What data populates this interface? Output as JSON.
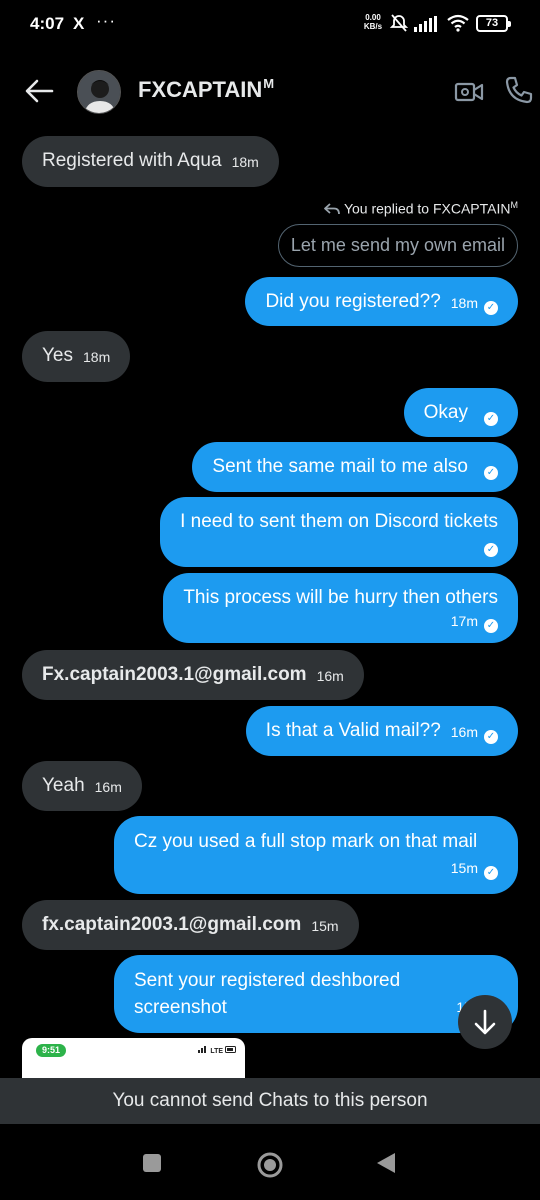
{
  "status_bar": {
    "time": "4:07",
    "x_icon": "X",
    "more": "···",
    "net_speed_value": "0.00",
    "net_speed_unit": "KB/s",
    "battery": "73"
  },
  "header": {
    "contact_name": "FXCAPTAIN",
    "contact_badge": "M"
  },
  "messages": [
    {
      "side": "in",
      "text": "Registered with Aqua",
      "time": "18m"
    },
    {
      "side": "out",
      "text": "Did you registered??",
      "time": "18m"
    },
    {
      "side": "in",
      "text": "Yes",
      "time": "18m"
    },
    {
      "side": "out",
      "text": "Okay",
      "time": ""
    },
    {
      "side": "out",
      "text": "Sent the same mail to me also",
      "time": ""
    },
    {
      "side": "out",
      "text": "I need to sent them on Discord tickets",
      "time": ""
    },
    {
      "side": "out",
      "text": "This process will be hurry then others",
      "time": "17m"
    },
    {
      "side": "in",
      "text": "Fx.captain2003.1@gmail.com",
      "time": "16m"
    },
    {
      "side": "out",
      "text": "Is that a Valid mail??",
      "time": "16m"
    },
    {
      "side": "in",
      "text": "Yeah",
      "time": "16m"
    },
    {
      "side": "out",
      "text": "Cz you used a full stop mark on that mail",
      "time": "15m"
    },
    {
      "side": "in",
      "text": "fx.captain2003.1@gmail.com",
      "time": "15m"
    },
    {
      "side": "out",
      "text": "Sent your registered deshbored screenshot",
      "time": "15"
    }
  ],
  "reply": {
    "note": "You replied to FXCAPTAIN",
    "note_badge": "M",
    "quoted_text": "Let me send my own email"
  },
  "thumbnail": {
    "time": "9:51",
    "status": "LTE"
  },
  "banner_text": "You cannot send Chats to this person",
  "icons": {
    "back": "back-arrow-icon",
    "video": "video-camera-icon",
    "call": "phone-icon",
    "scroll": "arrow-down-icon",
    "read": "checkmark-icon"
  },
  "colors": {
    "outgoing_bubble": "#1d9bf0",
    "incoming_bubble": "#2f3336",
    "background": "#000000"
  }
}
